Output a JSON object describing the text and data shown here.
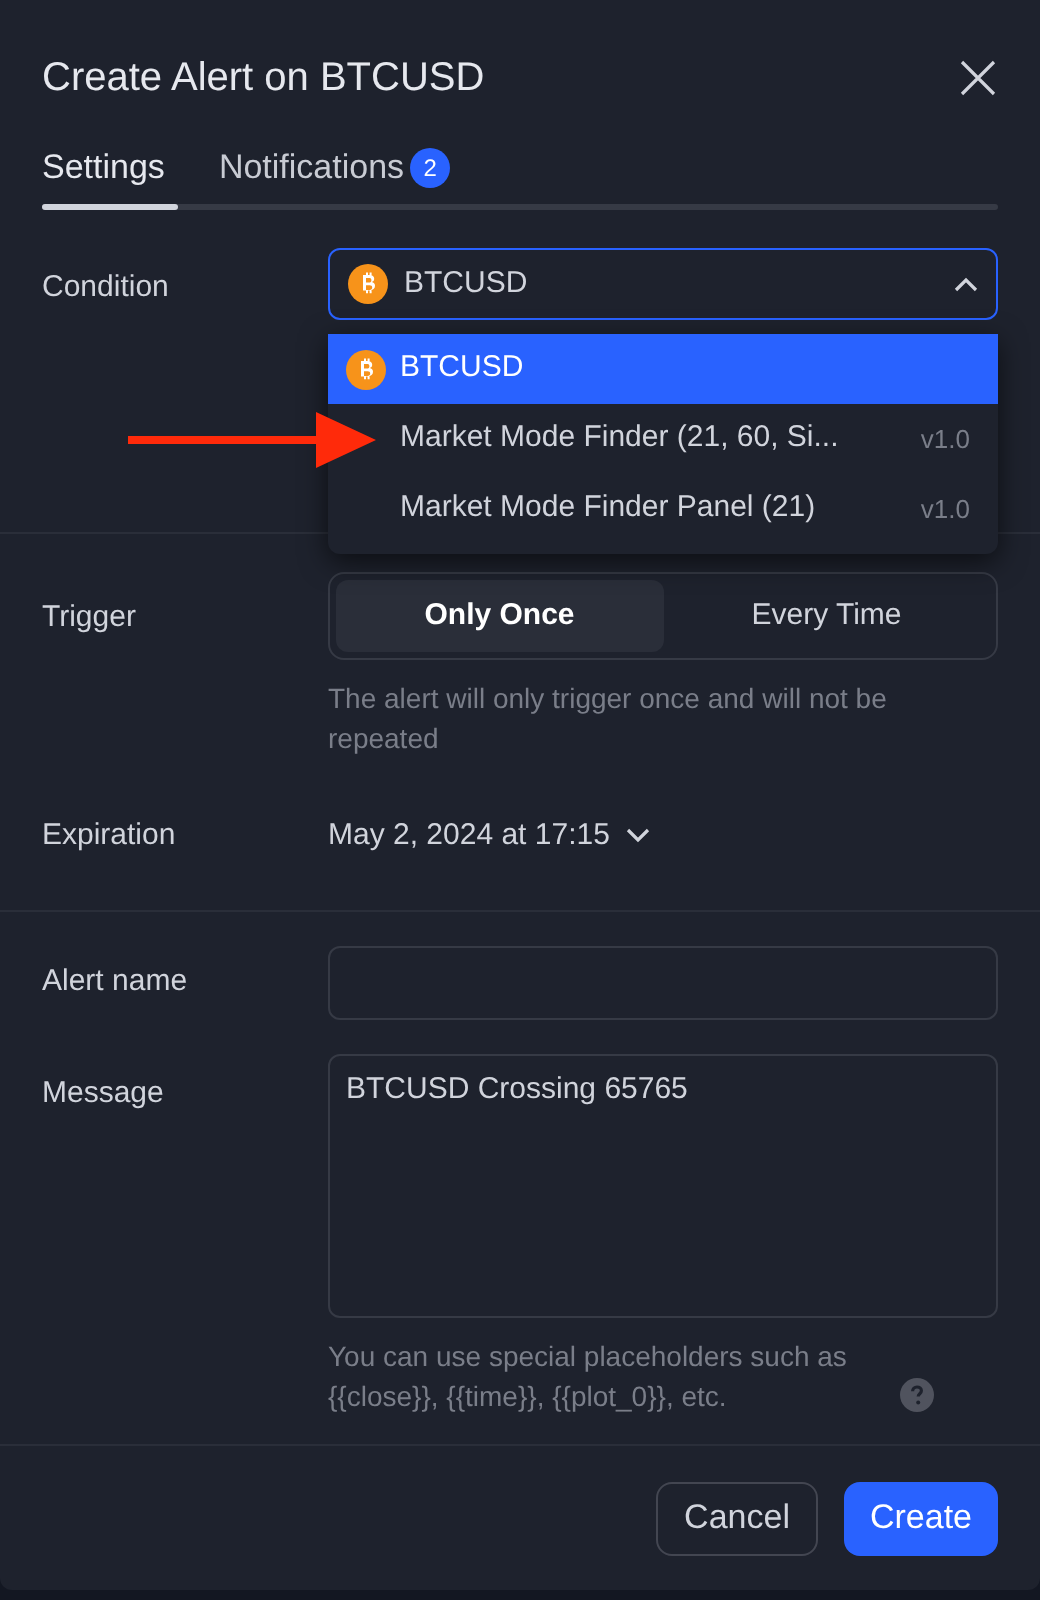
{
  "dialog": {
    "title": "Create Alert on BTCUSD"
  },
  "tabs": [
    {
      "label": "Settings",
      "selected": true
    },
    {
      "label": "Notifications",
      "selected": false,
      "badge": "2"
    }
  ],
  "condition": {
    "label": "Condition",
    "value": "BTCUSD",
    "expanded": true,
    "options": [
      {
        "label": "BTCUSD",
        "kind": "symbol",
        "selected": true
      },
      {
        "label": "Market Mode Finder (21, 60, Si...",
        "version": "v1.0",
        "kind": "script",
        "selected": false
      },
      {
        "label": "Market Mode Finder Panel (21)",
        "version": "v1.0",
        "kind": "script",
        "selected": false
      }
    ]
  },
  "trigger": {
    "label": "Trigger",
    "options": [
      {
        "label": "Only Once",
        "selected": true
      },
      {
        "label": "Every Time",
        "selected": false
      }
    ],
    "hint": "The alert will only trigger once and will not be repeated"
  },
  "expiration": {
    "label": "Expiration",
    "value": "May 2, 2024 at 17:15"
  },
  "alert_name": {
    "label": "Alert name"
  },
  "message": {
    "label": "Message",
    "value": "BTCUSD Crossing 65765",
    "hint": "You can use special placeholders such as {{close}}, {{time}}, {{plot_0}}, etc."
  },
  "buttons": [
    {
      "label": "Cancel",
      "kind": "secondary"
    },
    {
      "label": "Create",
      "kind": "primary"
    }
  ]
}
